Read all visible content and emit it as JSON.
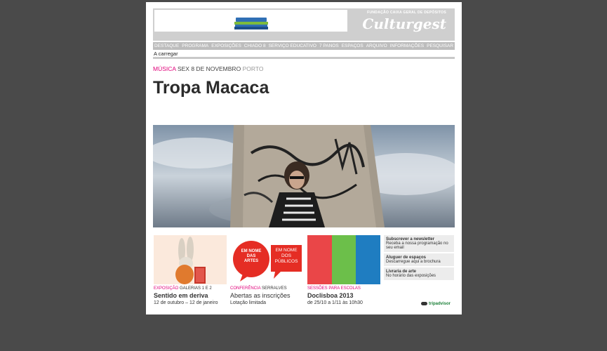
{
  "header": {
    "foundation": "FUNDAÇÃO CAIXA GERAL DE DEPÓSITOS",
    "logo": "Culturgest",
    "banner_icon": "stack-layers-icon"
  },
  "nav": {
    "items": [
      {
        "label": "DESTAQUE"
      },
      {
        "label": "PROGRAMA"
      },
      {
        "label": "EXPOSIÇÕES"
      },
      {
        "label": "CHIADO 8"
      },
      {
        "label": "SERVIÇO EDUCATIVO"
      },
      {
        "label": "7 PANOS"
      },
      {
        "label": "ESPAÇOS"
      },
      {
        "label": "ARQUIVO"
      },
      {
        "label": "INFORMAÇÕES"
      },
      {
        "label": "PESQUISAR"
      }
    ]
  },
  "loading_text": "A carregar",
  "event": {
    "category": "MÚSICA",
    "date": "SEX 8 DE NOVEMBRO",
    "location": "PORTO",
    "title": "Tropa Macaca"
  },
  "cards": [
    {
      "category": "EXPOSIÇÃO",
      "place": "GALERIAS 1 E 2",
      "title": "Sentido em deriva",
      "sub": "12 de outubro – 12 de janeiro"
    },
    {
      "category": "CONFERÊNCIA",
      "place": "SERRALVES",
      "title": "Abertas as inscrições",
      "sub": "Lotação limitada",
      "bubble_left": "EM NOME DAS ARTES",
      "bubble_right": "EM NOME DOS PÚBLICOS"
    },
    {
      "category": "SESSÕES PARA ESCOLAS",
      "place": "",
      "title": "Doclisboa 2013",
      "sub": "de 25/10 a 1/11 às 10h30"
    }
  ],
  "side": [
    {
      "heading": "Subscrever a newsletter",
      "text": "Receba a nossa programação no seu email"
    },
    {
      "heading": "Aluguer de espaços",
      "text": "Descarregue aqui a brochura"
    },
    {
      "heading": "Livraria de arte",
      "text": "No horário das exposições"
    }
  ],
  "tripadvisor": "tripadvisor",
  "colors": {
    "accent": "#e0007a",
    "nav_bg": "#bdbdbd",
    "stripe_red": "#ea4648",
    "stripe_green": "#6cbf4a",
    "stripe_blue": "#1f7dc1"
  }
}
